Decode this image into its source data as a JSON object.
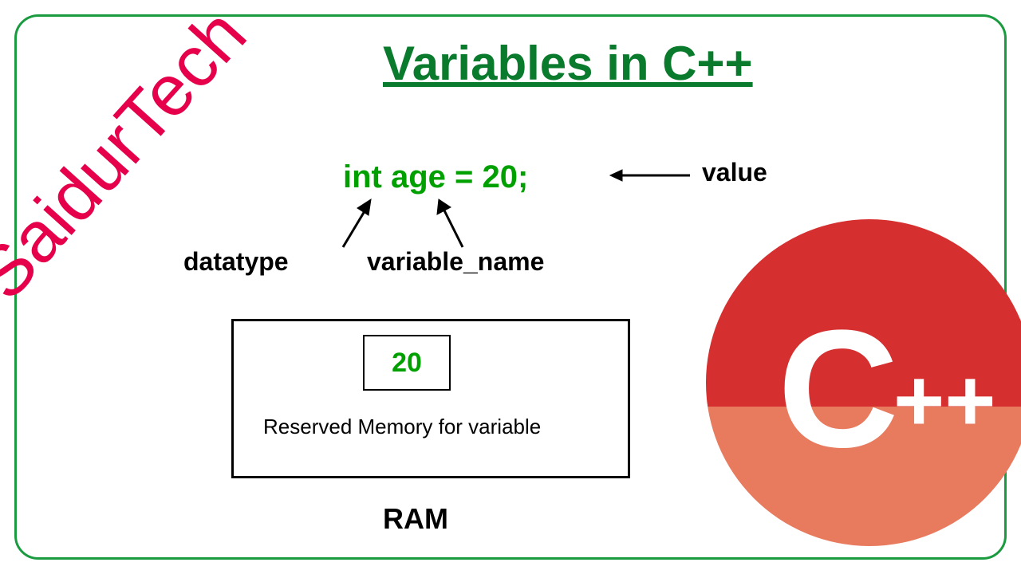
{
  "watermark": "SaidurTech",
  "title": "Variables in C++",
  "code": "int age = 20;",
  "labels": {
    "value": "value",
    "datatype": "datatype",
    "variable_name": "variable_name"
  },
  "memory": {
    "value": "20",
    "caption": "Reserved Memory for variable",
    "label": "RAM"
  },
  "logo": {
    "text": "C++"
  }
}
